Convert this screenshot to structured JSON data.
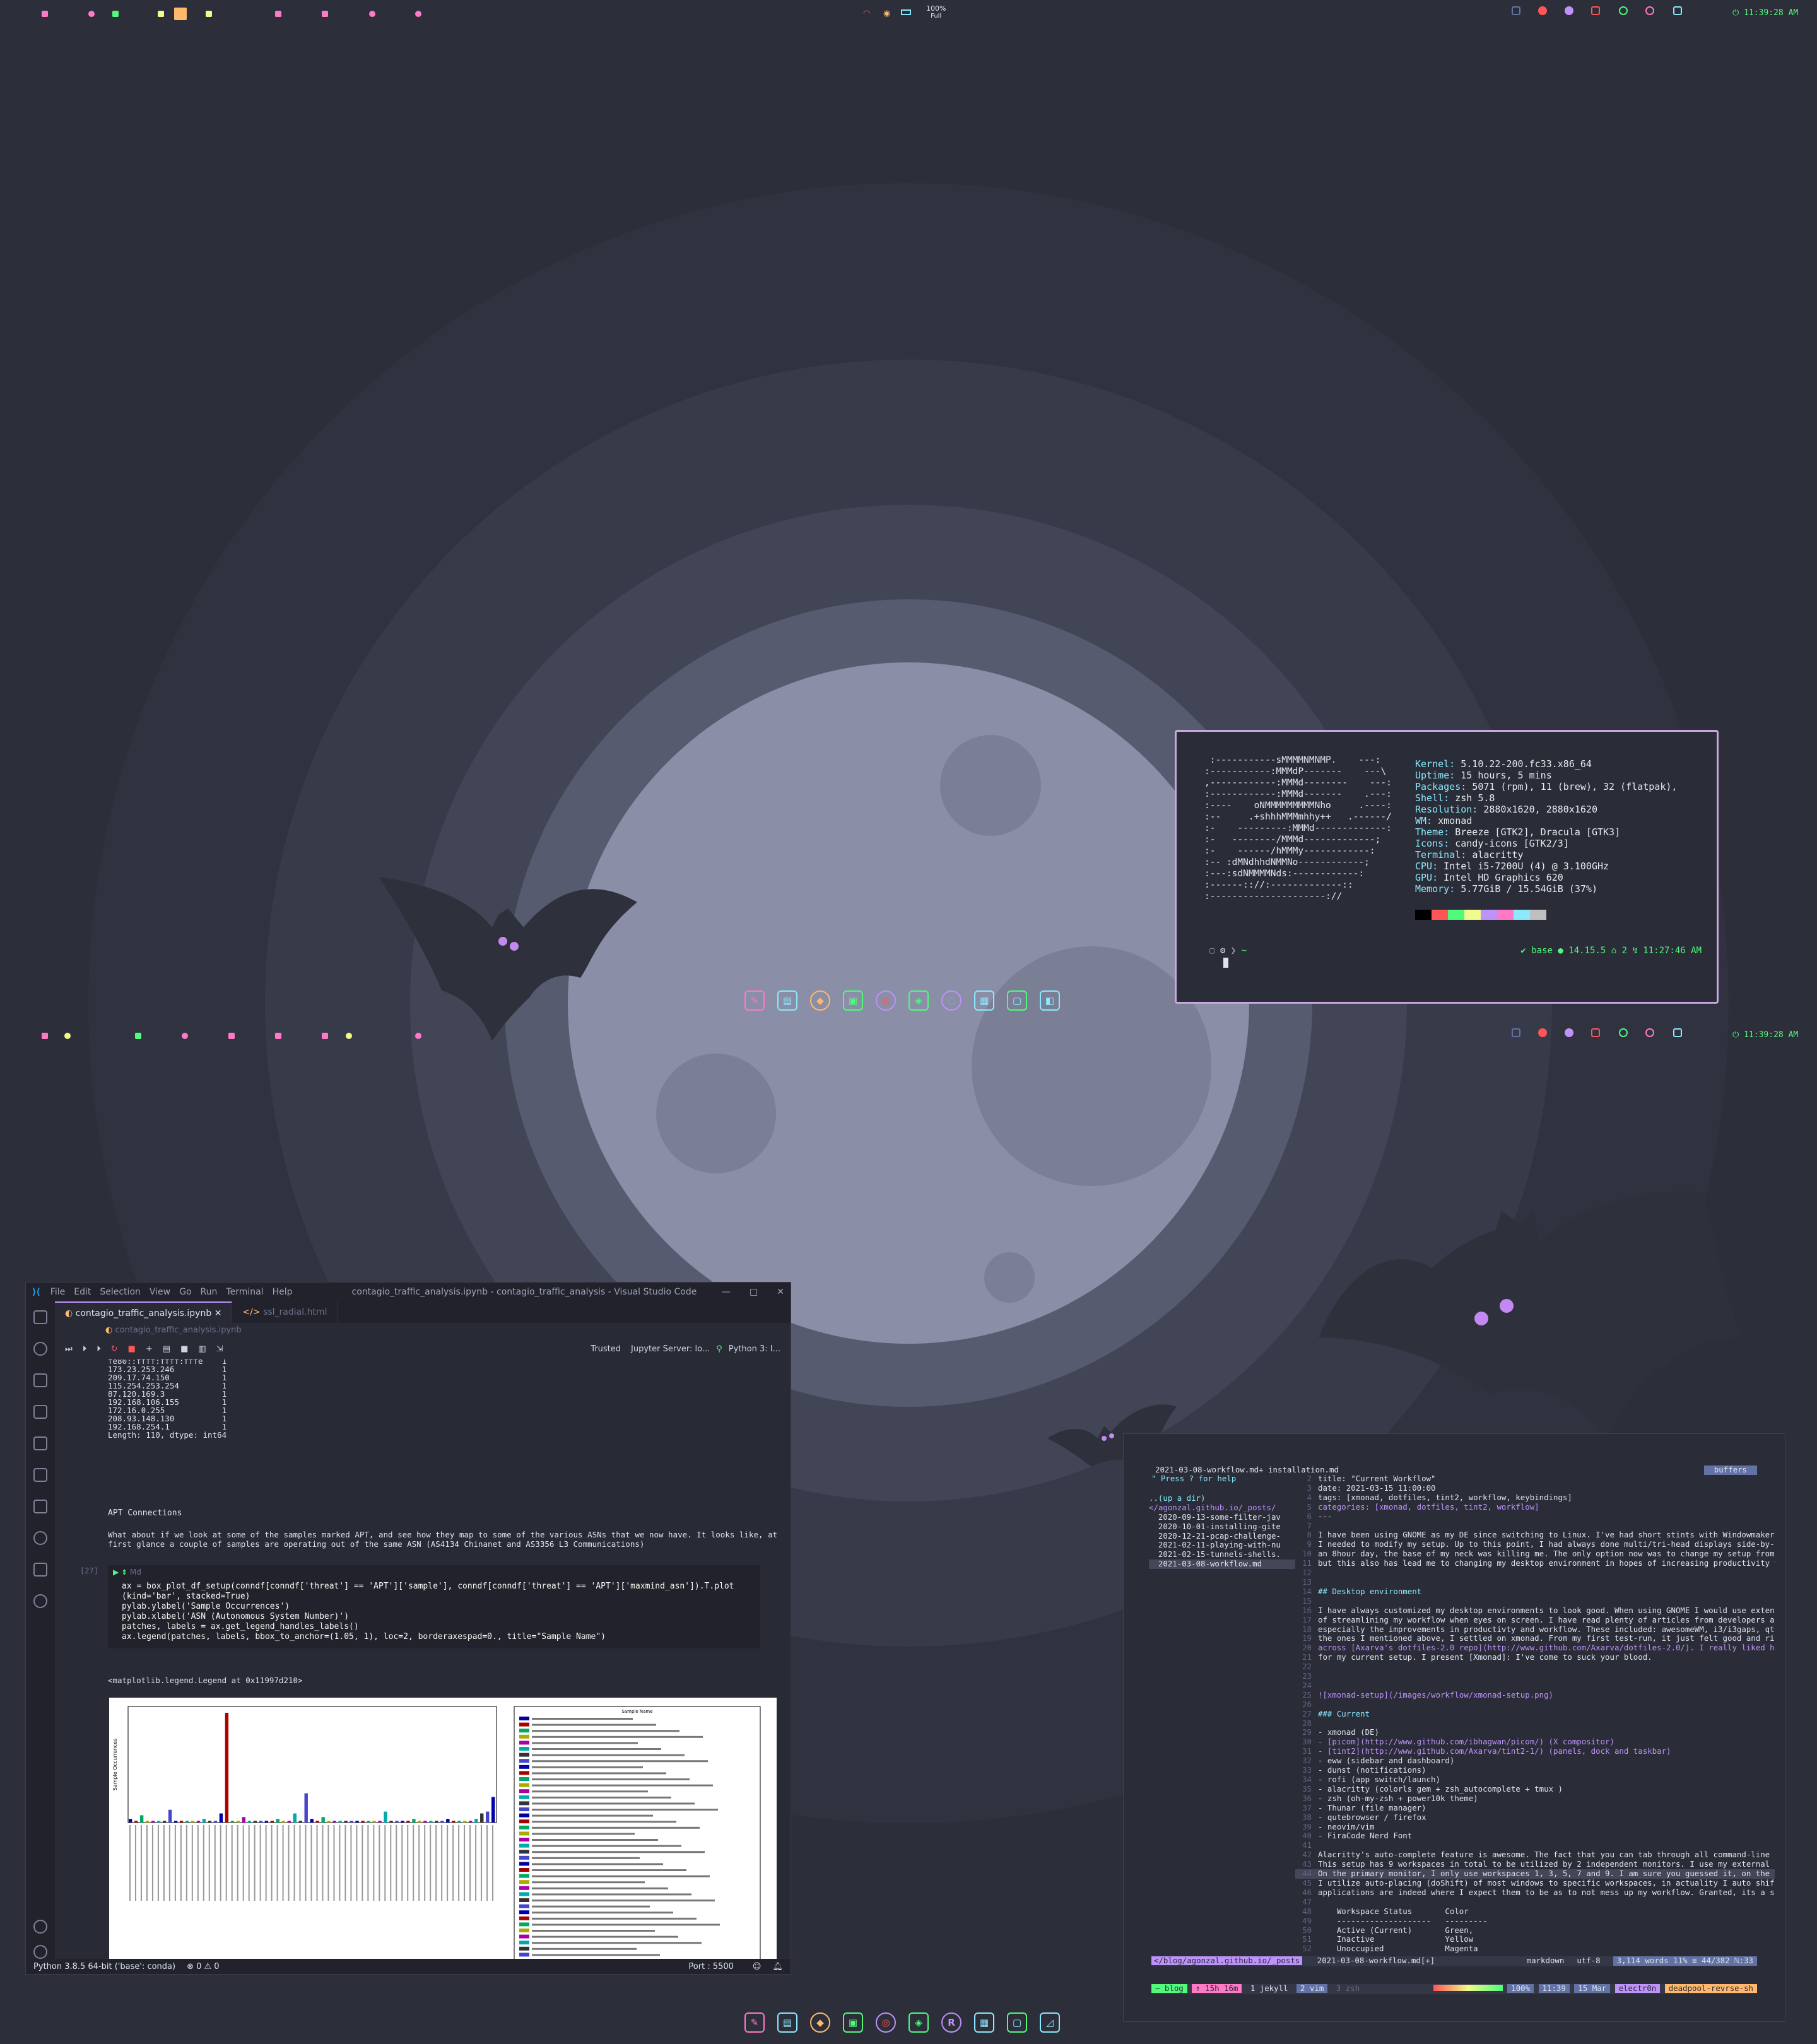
{
  "topbar": {
    "battery": "100%",
    "battery_sub": "Full",
    "clock": "11:39:28 AM"
  },
  "bottombar": {
    "clock": "11:39:28 AM"
  },
  "neofetch": {
    "logo": " :-----------sMMMMNMNMP.    ---:\n:-----------:MMMdP-------    ---\\\n,------------:MMMd--------    ---:\n:------------:MMMd-------    .---:\n:----    oNMMMMMMMMMNho     .----:\n:--     .+shhhMMMmhhy++   .------/\n:-    ---------:MMMd-------------:\n:-   --------/MMMd-------------;\n:-    ------/hMMMy------------:\n:-- :dMNdhhdNMMNo------------;\n:---:sdNMMMMNds:------------:\n:------:://:-------------::\n:---------------------://",
    "info": [
      {
        "k": "Kernel",
        "v": "5.10.22-200.fc33.x86_64"
      },
      {
        "k": "Uptime",
        "v": "15 hours, 5 mins"
      },
      {
        "k": "Packages",
        "v": "5071 (rpm), 11 (brew), 32 (flatpak),"
      },
      {
        "k": "Shell",
        "v": "zsh 5.8"
      },
      {
        "k": "Resolution",
        "v": "2880x1620, 2880x1620"
      },
      {
        "k": "WM",
        "v": "xmonad"
      },
      {
        "k": "Theme",
        "v": "Breeze [GTK2], Dracula [GTK3]"
      },
      {
        "k": "Icons",
        "v": "candy-icons [GTK2/3]"
      },
      {
        "k": "Terminal",
        "v": "alacritty"
      },
      {
        "k": "CPU",
        "v": "Intel i5-7200U (4) @ 3.100GHz"
      },
      {
        "k": "GPU",
        "v": "Intel HD Graphics 620"
      },
      {
        "k": "Memory",
        "v": "5.77GiB / 15.54GiB (37%)"
      }
    ],
    "palette": [
      "#000000",
      "#ff5555",
      "#50fa7b",
      "#f1fa8c",
      "#bd93f9",
      "#ff79c6",
      "#8be9fd",
      "#bfbfbf"
    ],
    "prompt_left": "~",
    "prompt_right": "✔ base ● 14.15.5 ⌂ 2 ↯ 11:27:46 AM"
  },
  "vscode": {
    "title": "contagio_traffic_analysis.ipynb - contagio_traffic_analysis - Visual Studio Code",
    "menu": [
      "File",
      "Edit",
      "Selection",
      "View",
      "Go",
      "Run",
      "Terminal",
      "Help"
    ],
    "tabs": [
      "contagio_traffic_analysis.ipynb",
      "ssl_radial.html"
    ],
    "breadcrumb": "contagio_traffic_analysis.ipynb",
    "trusted": "Trusted",
    "server": "Jupyter Server: lo...",
    "kernel": "Python 3: I...",
    "output": "fe80::ffff:ffff:fffe    1\n173.23.253.246          1\n209.17.74.150           1\n115.254.253.254         1\n87.120.169.3            1\n192.168.106.155         1\n172.16.0.255            1\n208.93.148.130          1\n192.168.254.1           1\nLength: 110, dtype: int64",
    "heading": "APT Connections",
    "para1": "What about if we look at some of the samples marked APT, and see how they map to some of the various ASNs that we now have. It looks like, at",
    "para2": "first glance a couple of samples are operating out of the same ASN (AS4134 Chinanet and AS3356 L3 Communications)",
    "cell_no": "[27]",
    "code": [
      "ax = box_plot_df_setup(conndf[conndf['threat'] == 'APT']['sample'], conndf[conndf['threat'] == 'APT']['maxmind_asn']).T.plot",
      "(kind='bar', stacked=True)",
      "pylab.ylabel('Sample Occurrences')",
      "pylab.xlabel('ASN (Autonomous System Number)')",
      "patches, labels = ax.get_legend_handles_labels()",
      "ax.legend(patches, labels, bbox_to_anchor=(1.05, 1), loc=2, borderaxespad=0., title=\"Sample Name\")"
    ],
    "result": "<matplotlib.legend.Legend at 0x11997d210>",
    "status_left": "Python 3.8.5 64-bit ('base': conda)",
    "status_errors": "⊗ 0 ⚠ 0",
    "status_port": "Port : 5500"
  },
  "chart_data": {
    "type": "bar",
    "title": "",
    "ylabel": "Sample Occurrences",
    "legend_title": "Sample Name",
    "values": [
      2,
      1,
      4,
      1,
      1,
      1,
      1,
      7,
      1,
      1,
      1,
      1,
      1,
      2,
      1,
      1,
      5,
      60,
      1,
      1,
      3,
      1,
      1,
      1,
      1,
      1,
      2,
      1,
      1,
      5,
      1,
      16,
      2,
      1,
      3,
      1,
      1,
      1,
      1,
      1,
      1,
      1,
      1,
      1,
      1,
      6,
      1,
      1,
      1,
      1,
      2,
      1,
      1,
      1,
      1,
      1,
      2,
      1,
      1,
      1,
      1,
      2,
      5,
      6,
      14
    ]
  },
  "nvim": {
    "tabline": "2021-03-08-workflow.md+  installation.md",
    "buffers": "buffers",
    "help": "\" Press ? for help",
    "tree": [
      "",
      "..(up a dir)",
      "</agonzal.github.io/_posts/",
      "  2020-09-13-some-filter-jav",
      "  2020-10-01-installing-gite",
      "  2020-12-21-pcap-challenge-",
      "  2021-02-11-playing-with-nu",
      "  2021-02-15-tunnels-shells.",
      "  2021-03-08-workflow.md"
    ],
    "lines": [
      "title: \"Current Workflow\"",
      "date: 2021-03-15 11:00:00",
      "tags: [xmonad, dotfiles, tint2, workflow, keybindings]",
      "categories: [xmonad, dotfiles, tint2, workflow]",
      "---",
      "",
      "I have been using GNOME as my DE since switching to Linux. I've had short stints with Windowmaker an",
      "I needed to modify my setup. Up to this point, I had always done multi/tri-head displays side-by-sid",
      "an 8hour day, the base of my neck was killing me. The only option now was to change my setup from ne",
      "but this also has lead me to changing my desktop environment in hopes of increasing productivity wit",
      "",
      "",
      "## Desktop environment",
      "",
      "I have always customized my desktop environments to look good. When using GNOME I would use extensio",
      "of streamlining my workflow when eyes on screen. I have read plenty of articles from developers and",
      "especially the improvements in productivty and workflow. These included: awesomeWM, i3/i3gaps, qtile",
      "the ones I mentioned above, I settled on xmonad. From my first test-run, it just felt good and right",
      "across [Axarva's dotfiles-2.0 repo](http://www.github.com/Axarva/dotfiles-2.0/). I really liked his",
      "for my current setup. I present [Xmonad]: I've come to suck your blood.",
      "",
      "",
      "",
      "![xmonad-setup](/images/workflow/xmonad-setup.png)",
      "",
      "### Current",
      "",
      "- xmonad (DE)",
      "- [picom](http://www.github.com/ibhagwan/picom/) (X compositor)",
      "- [tint2](http://www.github.com/Axarva/tint2-1/) (panels, dock and taskbar)",
      "- eww (sidebar and dashboard)",
      "- dunst (notifications)",
      "- rofi (app switch/launch)",
      "- alacritty (colorls gem + zsh_autocomplete + tmux )",
      "- zsh (oh-my-zsh + power10k theme)",
      "- Thunar (file manager)",
      "- qutebrowser / firefox",
      "- neovim/vim",
      "- FiraCode Nerd Font",
      "",
      "Alacritty's auto-complete feature is awesome. The fact that you can tab through all command-line swi",
      "This setup has 9 workspaces in total to be utilized by 2 independent monitors. I use my external 32\"",
      "On the primary monitor, I only use workspaces 1, 3, 5, 7 and 9. I am sure you guessed it, on the lap",
      "I utilize auto-placing (doShift) of most windows to specific workspaces, in actuality I auto shift e",
      "applications are indeed where I expect them to be as to not mess up my workflow. Granted, its a simp",
      "",
      "    Workspace Status       Color",
      "    --------------------   ---------",
      "    Active (Current)       Green,",
      "    Inactive               Yellow",
      "    Unoccupied             Magenta"
    ],
    "status_left": "</blog/agonzal.github.io/_posts",
    "status_file": "2021-03-08-workflow.md[+]",
    "status_mode": "markdown",
    "status_enc": "utf-8",
    "status_words": "3,114 words  11% ≡ 44/382 ℕ:33",
    "tmux": [
      "~ blog",
      "↑ 15h 16m",
      "1 jekyll",
      "2 vim",
      "3 zsh"
    ],
    "tmux_right": [
      "100%",
      "11:39",
      "15 Mar",
      "electr0n",
      "deadpool-revrse-sh"
    ]
  }
}
